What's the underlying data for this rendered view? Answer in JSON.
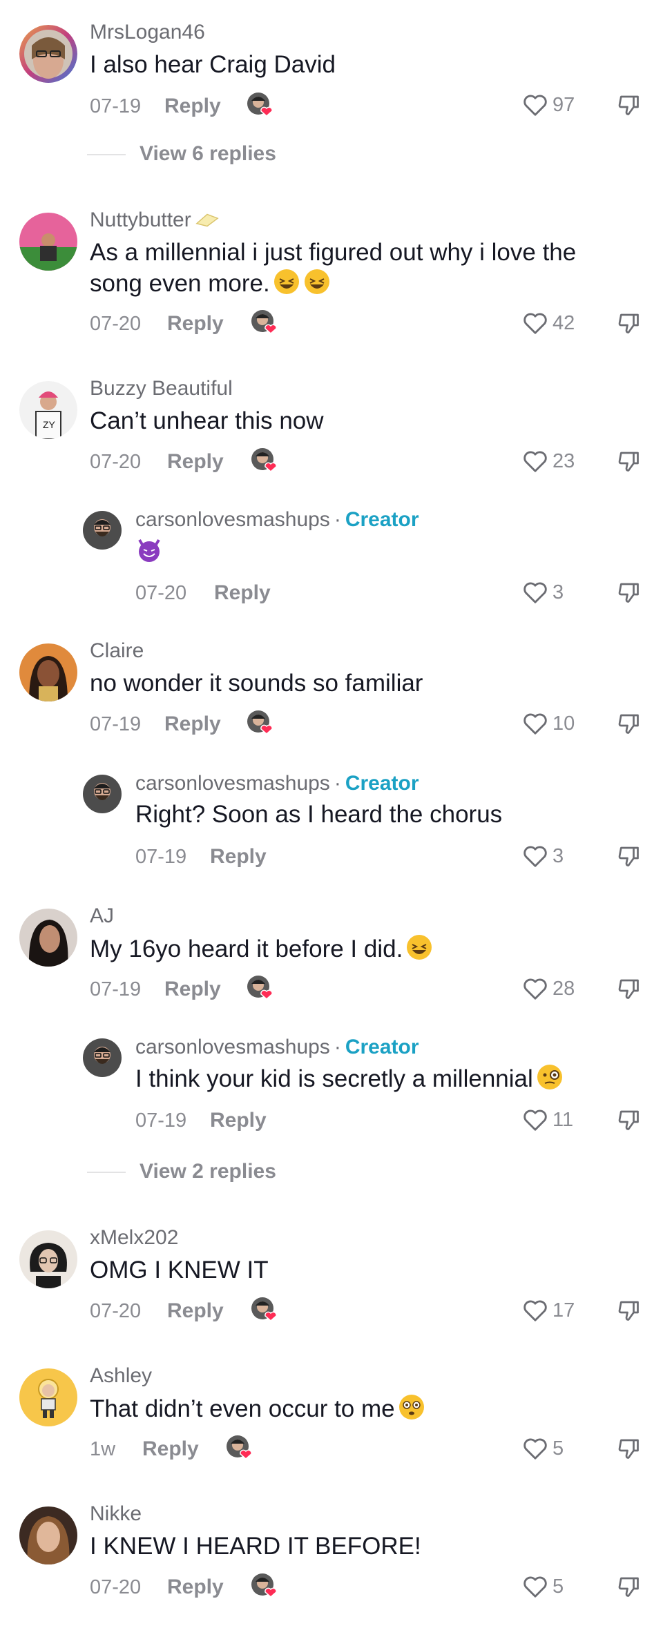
{
  "comments": [
    {
      "username": "MrsLogan46",
      "text": "I also hear Craig David",
      "date": "07-19",
      "reply": "Reply",
      "likes": "97",
      "view_replies": "View 6 replies"
    },
    {
      "username": "Nuttybutter",
      "text_line1": "As a millennial i just figured out why i love the",
      "text_line2": "song even more.",
      "date": "07-20",
      "reply": "Reply",
      "likes": "42"
    },
    {
      "username": "Buzzy Beautiful",
      "text": "Can’t unhear this now",
      "date": "07-20",
      "reply": "Reply",
      "likes": "23",
      "reply_item": {
        "username": "carsonlovesmashups",
        "dot": "·",
        "badge": "Creator",
        "text": "",
        "date": "07-20",
        "reply": "Reply",
        "likes": "3"
      }
    },
    {
      "username": "Claire",
      "text": "no wonder it sounds so familiar",
      "date": "07-19",
      "reply": "Reply",
      "likes": "10",
      "reply_item": {
        "username": "carsonlovesmashups",
        "dot": "·",
        "badge": "Creator",
        "text": "Right? Soon as I heard the chorus",
        "date": "07-19",
        "reply": "Reply",
        "likes": "3"
      }
    },
    {
      "username": "AJ",
      "text": "My 16yo heard it before I did.",
      "date": "07-19",
      "reply": "Reply",
      "likes": "28",
      "reply_item": {
        "username": "carsonlovesmashups",
        "dot": "·",
        "badge": "Creator",
        "text": "I think your kid is secretly a millennial",
        "date": "07-19",
        "reply": "Reply",
        "likes": "11"
      },
      "view_replies": "View 2 replies"
    },
    {
      "username": "xMelx202",
      "text": "OMG I KNEW IT",
      "date": "07-20",
      "reply": "Reply",
      "likes": "17"
    },
    {
      "username": "Ashley",
      "text": "That didn’t even occur to me",
      "date": "1w",
      "reply": "Reply",
      "likes": "5"
    },
    {
      "username": "Nikke",
      "text": "I KNEW I HEARD IT BEFORE!",
      "date": "07-20",
      "reply": "Reply",
      "likes": "5"
    }
  ],
  "icons": {
    "like": "heart-outline-icon",
    "dislike": "thumbs-down-icon",
    "creator_liked": "creator-liked-avatar-icon"
  },
  "colors": {
    "creator_badge": "#1ba1c4",
    "secondary_text": "#8a8b91",
    "heart": "#fe2c55"
  }
}
